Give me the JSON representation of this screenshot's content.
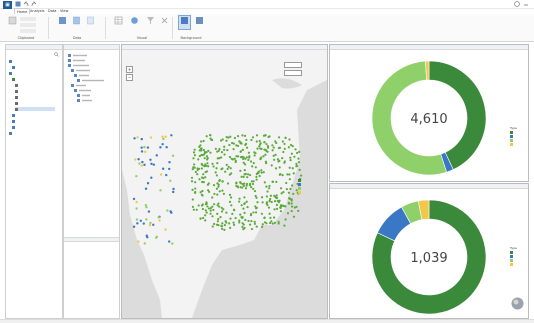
{
  "window": {
    "title": ""
  },
  "ribbon": {
    "tabs": [
      {
        "label": "Home",
        "active": true
      },
      {
        "label": "Analysis",
        "active": false
      },
      {
        "label": "Data",
        "active": false
      },
      {
        "label": "View",
        "active": false
      }
    ],
    "groups": [
      {
        "label": "Clipboard"
      },
      {
        "label": "Data"
      },
      {
        "label": "Visual"
      },
      {
        "label": "Background"
      }
    ]
  },
  "left_panel": {
    "header": "",
    "items": [
      {
        "label": "",
        "color": "#4a7ebb"
      },
      {
        "label": "",
        "color": "#4a7ebb"
      },
      {
        "label": "",
        "color": "#4a7ebb"
      },
      {
        "label": "",
        "color": "#3a8a3a"
      },
      {
        "label": "",
        "color": "#6a6a6a"
      },
      {
        "label": "",
        "color": "#6a6a6a"
      },
      {
        "label": "",
        "color": "#6a6a6a"
      },
      {
        "label": "",
        "color": "#6a6a6a"
      },
      {
        "label": "",
        "color": "#6a6a6a"
      },
      {
        "label": "",
        "color": "#4a7ebb"
      },
      {
        "label": "",
        "color": "#4a7ebb"
      },
      {
        "label": "",
        "color": "#4a7ebb"
      },
      {
        "label": "",
        "color": "#4a7ebb"
      }
    ]
  },
  "mid_panel": {
    "header": "",
    "footer": ""
  },
  "map": {
    "header": "",
    "zoom_plus": "+",
    "zoom_minus": "−",
    "attribution": "",
    "legend_title": "",
    "legend": [
      {
        "label": "",
        "color": "#3b8a3b"
      },
      {
        "label": "",
        "color": "#3a78c5"
      },
      {
        "label": "",
        "color": "#8fd06b"
      },
      {
        "label": "",
        "color": "#f2c84b"
      }
    ]
  },
  "chart_top": {
    "header": "",
    "center_value": "4,610",
    "legend_title": "Type",
    "axis_caption": ""
  },
  "chart_bottom": {
    "header": "",
    "center_value": "1,039",
    "legend_title": "Type",
    "axis_caption": ""
  },
  "chart_data": [
    {
      "type": "pie",
      "title": "",
      "labels": [
        "",
        "",
        "",
        ""
      ],
      "values": [
        0.43,
        0.02,
        0.54,
        0.01
      ],
      "colors": [
        "#3b8a3b",
        "#3a78c5",
        "#8fd06b",
        "#f2c84b"
      ],
      "center_label": "4,610"
    },
    {
      "type": "pie",
      "title": "",
      "labels": [
        "",
        "",
        "",
        ""
      ],
      "values": [
        0.82,
        0.1,
        0.05,
        0.03
      ],
      "colors": [
        "#3b8a3b",
        "#3a78c5",
        "#8fd06b",
        "#f2c84b"
      ],
      "center_label": "1,039"
    }
  ]
}
